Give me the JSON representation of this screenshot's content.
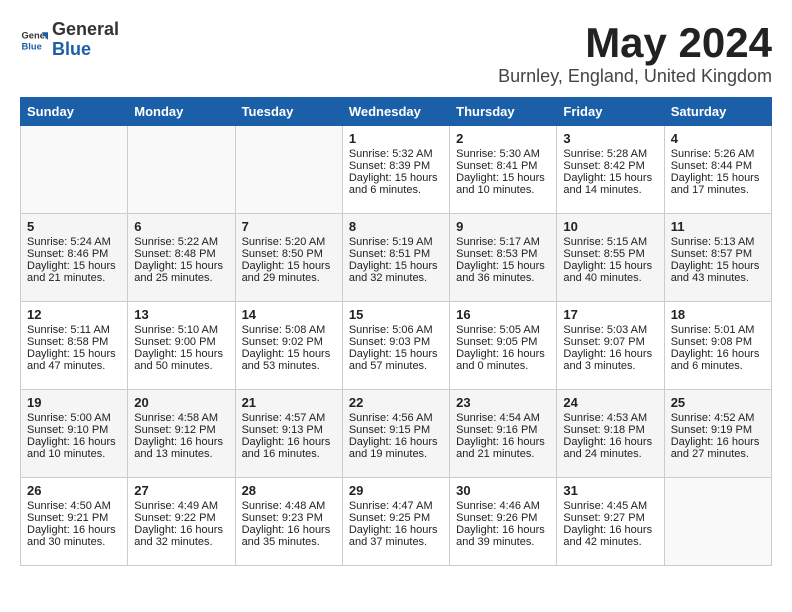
{
  "header": {
    "logo_general": "General",
    "logo_blue": "Blue",
    "title": "May 2024",
    "subtitle": "Burnley, England, United Kingdom"
  },
  "days_of_week": [
    "Sunday",
    "Monday",
    "Tuesday",
    "Wednesday",
    "Thursday",
    "Friday",
    "Saturday"
  ],
  "weeks": [
    [
      {
        "day": "",
        "content": ""
      },
      {
        "day": "",
        "content": ""
      },
      {
        "day": "",
        "content": ""
      },
      {
        "day": "1",
        "content": "Sunrise: 5:32 AM\nSunset: 8:39 PM\nDaylight: 15 hours\nand 6 minutes."
      },
      {
        "day": "2",
        "content": "Sunrise: 5:30 AM\nSunset: 8:41 PM\nDaylight: 15 hours\nand 10 minutes."
      },
      {
        "day": "3",
        "content": "Sunrise: 5:28 AM\nSunset: 8:42 PM\nDaylight: 15 hours\nand 14 minutes."
      },
      {
        "day": "4",
        "content": "Sunrise: 5:26 AM\nSunset: 8:44 PM\nDaylight: 15 hours\nand 17 minutes."
      }
    ],
    [
      {
        "day": "5",
        "content": "Sunrise: 5:24 AM\nSunset: 8:46 PM\nDaylight: 15 hours\nand 21 minutes."
      },
      {
        "day": "6",
        "content": "Sunrise: 5:22 AM\nSunset: 8:48 PM\nDaylight: 15 hours\nand 25 minutes."
      },
      {
        "day": "7",
        "content": "Sunrise: 5:20 AM\nSunset: 8:50 PM\nDaylight: 15 hours\nand 29 minutes."
      },
      {
        "day": "8",
        "content": "Sunrise: 5:19 AM\nSunset: 8:51 PM\nDaylight: 15 hours\nand 32 minutes."
      },
      {
        "day": "9",
        "content": "Sunrise: 5:17 AM\nSunset: 8:53 PM\nDaylight: 15 hours\nand 36 minutes."
      },
      {
        "day": "10",
        "content": "Sunrise: 5:15 AM\nSunset: 8:55 PM\nDaylight: 15 hours\nand 40 minutes."
      },
      {
        "day": "11",
        "content": "Sunrise: 5:13 AM\nSunset: 8:57 PM\nDaylight: 15 hours\nand 43 minutes."
      }
    ],
    [
      {
        "day": "12",
        "content": "Sunrise: 5:11 AM\nSunset: 8:58 PM\nDaylight: 15 hours\nand 47 minutes."
      },
      {
        "day": "13",
        "content": "Sunrise: 5:10 AM\nSunset: 9:00 PM\nDaylight: 15 hours\nand 50 minutes."
      },
      {
        "day": "14",
        "content": "Sunrise: 5:08 AM\nSunset: 9:02 PM\nDaylight: 15 hours\nand 53 minutes."
      },
      {
        "day": "15",
        "content": "Sunrise: 5:06 AM\nSunset: 9:03 PM\nDaylight: 15 hours\nand 57 minutes."
      },
      {
        "day": "16",
        "content": "Sunrise: 5:05 AM\nSunset: 9:05 PM\nDaylight: 16 hours\nand 0 minutes."
      },
      {
        "day": "17",
        "content": "Sunrise: 5:03 AM\nSunset: 9:07 PM\nDaylight: 16 hours\nand 3 minutes."
      },
      {
        "day": "18",
        "content": "Sunrise: 5:01 AM\nSunset: 9:08 PM\nDaylight: 16 hours\nand 6 minutes."
      }
    ],
    [
      {
        "day": "19",
        "content": "Sunrise: 5:00 AM\nSunset: 9:10 PM\nDaylight: 16 hours\nand 10 minutes."
      },
      {
        "day": "20",
        "content": "Sunrise: 4:58 AM\nSunset: 9:12 PM\nDaylight: 16 hours\nand 13 minutes."
      },
      {
        "day": "21",
        "content": "Sunrise: 4:57 AM\nSunset: 9:13 PM\nDaylight: 16 hours\nand 16 minutes."
      },
      {
        "day": "22",
        "content": "Sunrise: 4:56 AM\nSunset: 9:15 PM\nDaylight: 16 hours\nand 19 minutes."
      },
      {
        "day": "23",
        "content": "Sunrise: 4:54 AM\nSunset: 9:16 PM\nDaylight: 16 hours\nand 21 minutes."
      },
      {
        "day": "24",
        "content": "Sunrise: 4:53 AM\nSunset: 9:18 PM\nDaylight: 16 hours\nand 24 minutes."
      },
      {
        "day": "25",
        "content": "Sunrise: 4:52 AM\nSunset: 9:19 PM\nDaylight: 16 hours\nand 27 minutes."
      }
    ],
    [
      {
        "day": "26",
        "content": "Sunrise: 4:50 AM\nSunset: 9:21 PM\nDaylight: 16 hours\nand 30 minutes."
      },
      {
        "day": "27",
        "content": "Sunrise: 4:49 AM\nSunset: 9:22 PM\nDaylight: 16 hours\nand 32 minutes."
      },
      {
        "day": "28",
        "content": "Sunrise: 4:48 AM\nSunset: 9:23 PM\nDaylight: 16 hours\nand 35 minutes."
      },
      {
        "day": "29",
        "content": "Sunrise: 4:47 AM\nSunset: 9:25 PM\nDaylight: 16 hours\nand 37 minutes."
      },
      {
        "day": "30",
        "content": "Sunrise: 4:46 AM\nSunset: 9:26 PM\nDaylight: 16 hours\nand 39 minutes."
      },
      {
        "day": "31",
        "content": "Sunrise: 4:45 AM\nSunset: 9:27 PM\nDaylight: 16 hours\nand 42 minutes."
      },
      {
        "day": "",
        "content": ""
      }
    ]
  ]
}
